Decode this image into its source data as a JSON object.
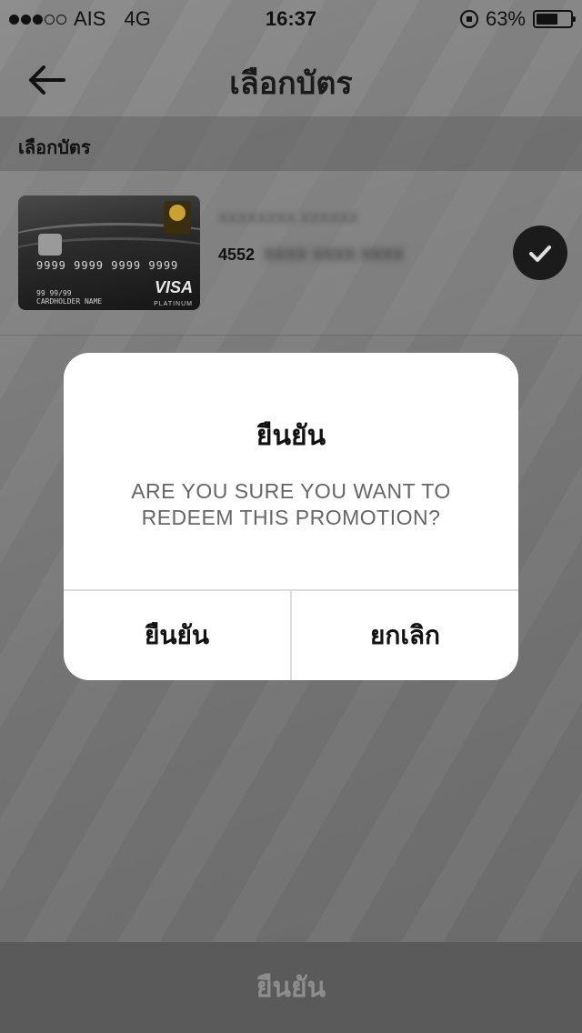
{
  "status_bar": {
    "signal_dots": [
      true,
      true,
      true,
      false,
      false
    ],
    "carrier": "AIS",
    "network": "4G",
    "time": "16:37",
    "battery_percent_label": "63%",
    "battery_level": 0.63
  },
  "nav": {
    "back_icon": "arrow-left-icon",
    "title": "เลือกบัตร"
  },
  "section": {
    "header": "เลือกบัตร"
  },
  "card": {
    "card_art": {
      "number": "9999 9999 9999 9999",
      "holder": "CARDHOLDER NAME",
      "valid": "99 99/99",
      "brand": "VISA",
      "tier": "PLATINUM"
    },
    "holder_name_blurred": "XXXXXXXX XXXXXX",
    "number_prefix": "4552",
    "number_rest_blurred": "XXXX XXXX XXXX",
    "selected": true,
    "check_icon": "checkmark-icon"
  },
  "dialog": {
    "title": "ยืนยัน",
    "message": "ARE YOU SURE YOU WANT TO REDEEM THIS PROMOTION?",
    "confirm_label": "ยืนยัน",
    "cancel_label": "ยกเลิก"
  },
  "bottom_button": {
    "label": "ยืนยัน"
  }
}
